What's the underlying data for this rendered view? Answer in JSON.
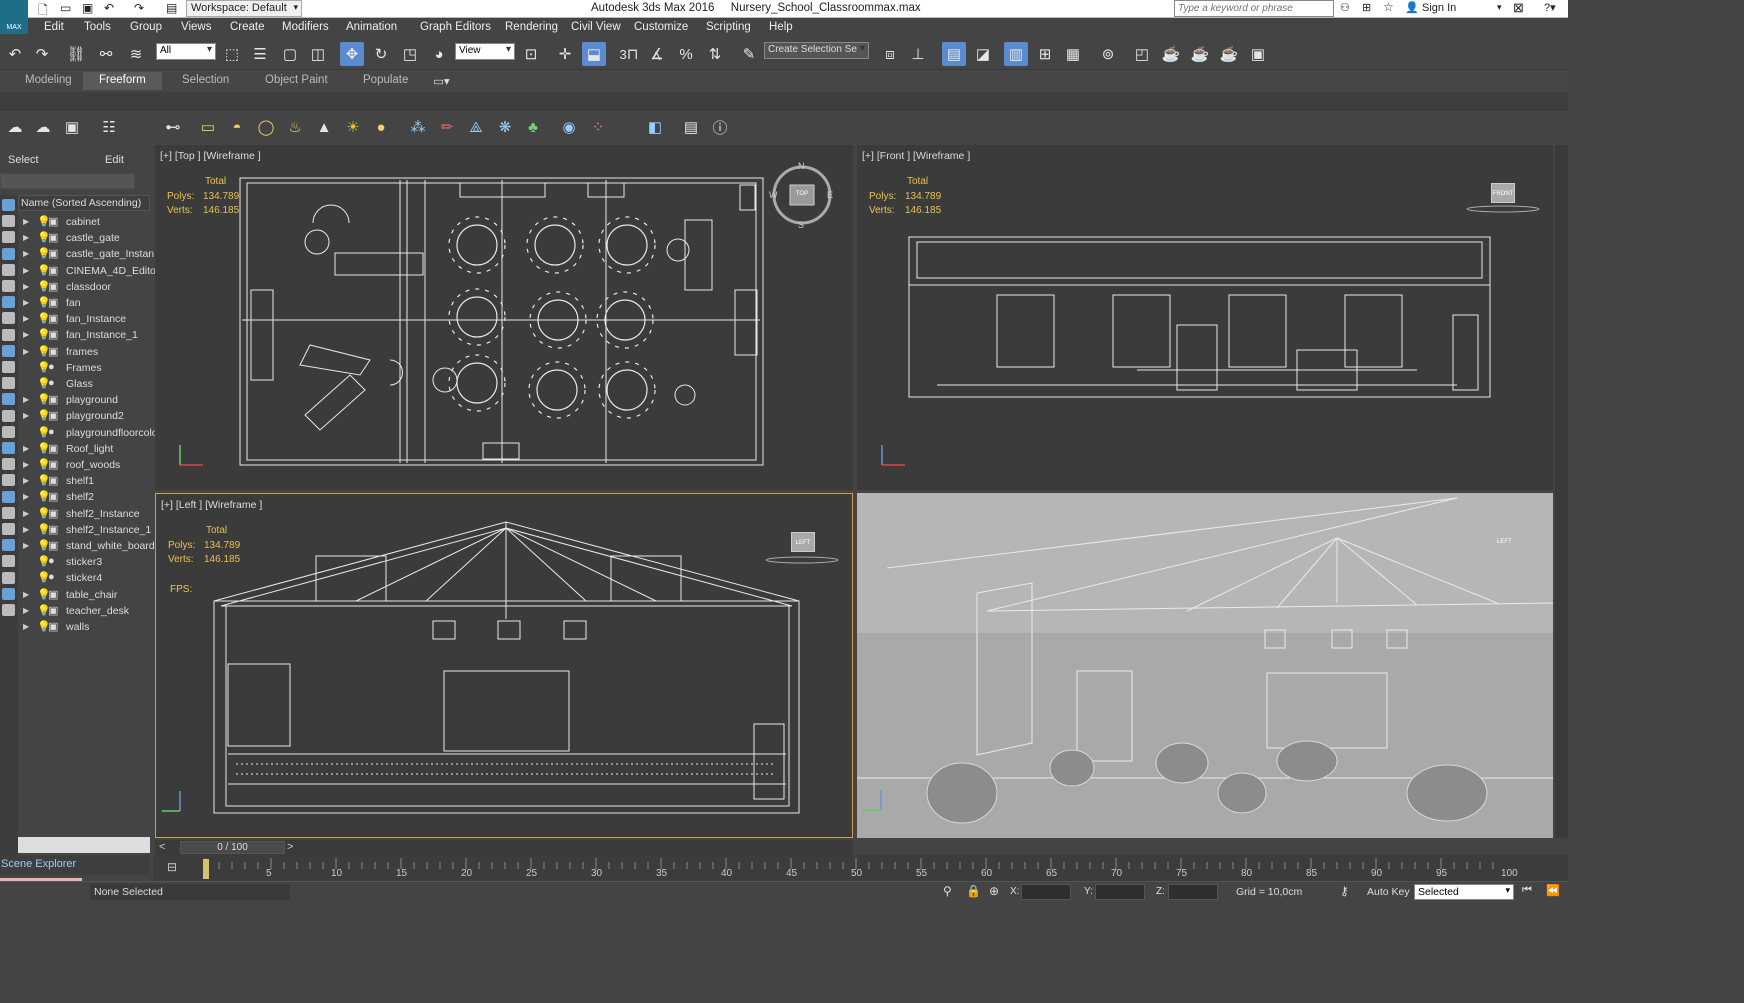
{
  "app": {
    "title": "Autodesk 3ds Max 2016",
    "file": "Nursery_School_Classroommax.max",
    "logo": "MAX",
    "workspace": "Workspace: Default",
    "search_placeholder": "Type a keyword or phrase",
    "sign_in": "Sign In"
  },
  "menu": [
    "Edit",
    "Tools",
    "Group",
    "Views",
    "Create",
    "Modifiers",
    "Animation",
    "Graph Editors",
    "Rendering",
    "Civil View",
    "Customize",
    "Scripting",
    "Help"
  ],
  "toolbar": {
    "selection_filter": "All",
    "ref_coord": "View",
    "named_selection": "Create Selection Se",
    "snap_label": "3"
  },
  "ribbon_tabs": [
    "Modeling",
    "Freeform",
    "Selection",
    "Object Paint",
    "Populate"
  ],
  "ribbon_active": "Freeform",
  "explorer": {
    "tab_select": "Select",
    "tab_edit": "Edit",
    "column_header": "Name (Sorted Ascending)",
    "footer": "Scene Explorer",
    "items": [
      {
        "name": "cabinet",
        "expand": true,
        "light": true
      },
      {
        "name": "castle_gate",
        "expand": true,
        "light": true
      },
      {
        "name": "castle_gate_Instan",
        "expand": true,
        "light": true
      },
      {
        "name": "CINEMA_4D_Editor",
        "expand": true,
        "light": true
      },
      {
        "name": "classdoor",
        "expand": true,
        "light": true
      },
      {
        "name": "fan",
        "expand": true,
        "light": true
      },
      {
        "name": "fan_Instance",
        "expand": true,
        "light": true
      },
      {
        "name": "fan_Instance_1",
        "expand": true,
        "light": true
      },
      {
        "name": "frames",
        "expand": true,
        "light": true
      },
      {
        "name": "Frames",
        "expand": false,
        "light": true
      },
      {
        "name": "Glass",
        "expand": false,
        "light": true
      },
      {
        "name": "playground",
        "expand": true,
        "light": true
      },
      {
        "name": "playground2",
        "expand": true,
        "light": true
      },
      {
        "name": "playgroundfloorcolo",
        "expand": false,
        "light": true
      },
      {
        "name": "Roof_light",
        "expand": true,
        "light": true
      },
      {
        "name": "roof_woods",
        "expand": true,
        "light": true
      },
      {
        "name": "shelf1",
        "expand": true,
        "light": true
      },
      {
        "name": "shelf2",
        "expand": true,
        "light": true
      },
      {
        "name": "shelf2_Instance",
        "expand": true,
        "light": true
      },
      {
        "name": "shelf2_Instance_1",
        "expand": true,
        "light": true
      },
      {
        "name": "stand_white_board",
        "expand": true,
        "light": true
      },
      {
        "name": "sticker3",
        "expand": false,
        "light": true
      },
      {
        "name": "sticker4",
        "expand": false,
        "light": true
      },
      {
        "name": "table_chair",
        "expand": true,
        "light": true
      },
      {
        "name": "teacher_desk",
        "expand": true,
        "light": true
      },
      {
        "name": "walls",
        "expand": true,
        "light": true
      }
    ]
  },
  "viewports": {
    "top": {
      "label": "[+] [Top ] [Wireframe ]",
      "cube": "TOP"
    },
    "front": {
      "label": "[+] [Front ] [Wireframe ]",
      "cube": "FRONT"
    },
    "left": {
      "label": "[+] [Left ] [Wireframe ]",
      "cube": "LEFT",
      "fps": "FPS:"
    },
    "persp": {
      "cube": "LEFT"
    },
    "stats": {
      "total": "Total",
      "polys_label": "Polys:",
      "polys": "134.789",
      "verts_label": "Verts:",
      "verts": "146.185"
    },
    "compass": {
      "n": "N",
      "s": "S",
      "e": "E",
      "w": "W"
    }
  },
  "timeline": {
    "frame": "0 / 100",
    "prev": "<",
    "next": ">",
    "ticks": [
      "5",
      "10",
      "15",
      "20",
      "25",
      "30",
      "35",
      "40",
      "45",
      "50",
      "55",
      "60",
      "65",
      "70",
      "75",
      "80",
      "85",
      "90",
      "95",
      "100"
    ]
  },
  "status": {
    "selection": "None Selected",
    "x": "X:",
    "y": "Y:",
    "z": "Z:",
    "grid": "Grid = 10,0cm",
    "auto_key": "Auto Key",
    "key_filter": "Selected"
  }
}
